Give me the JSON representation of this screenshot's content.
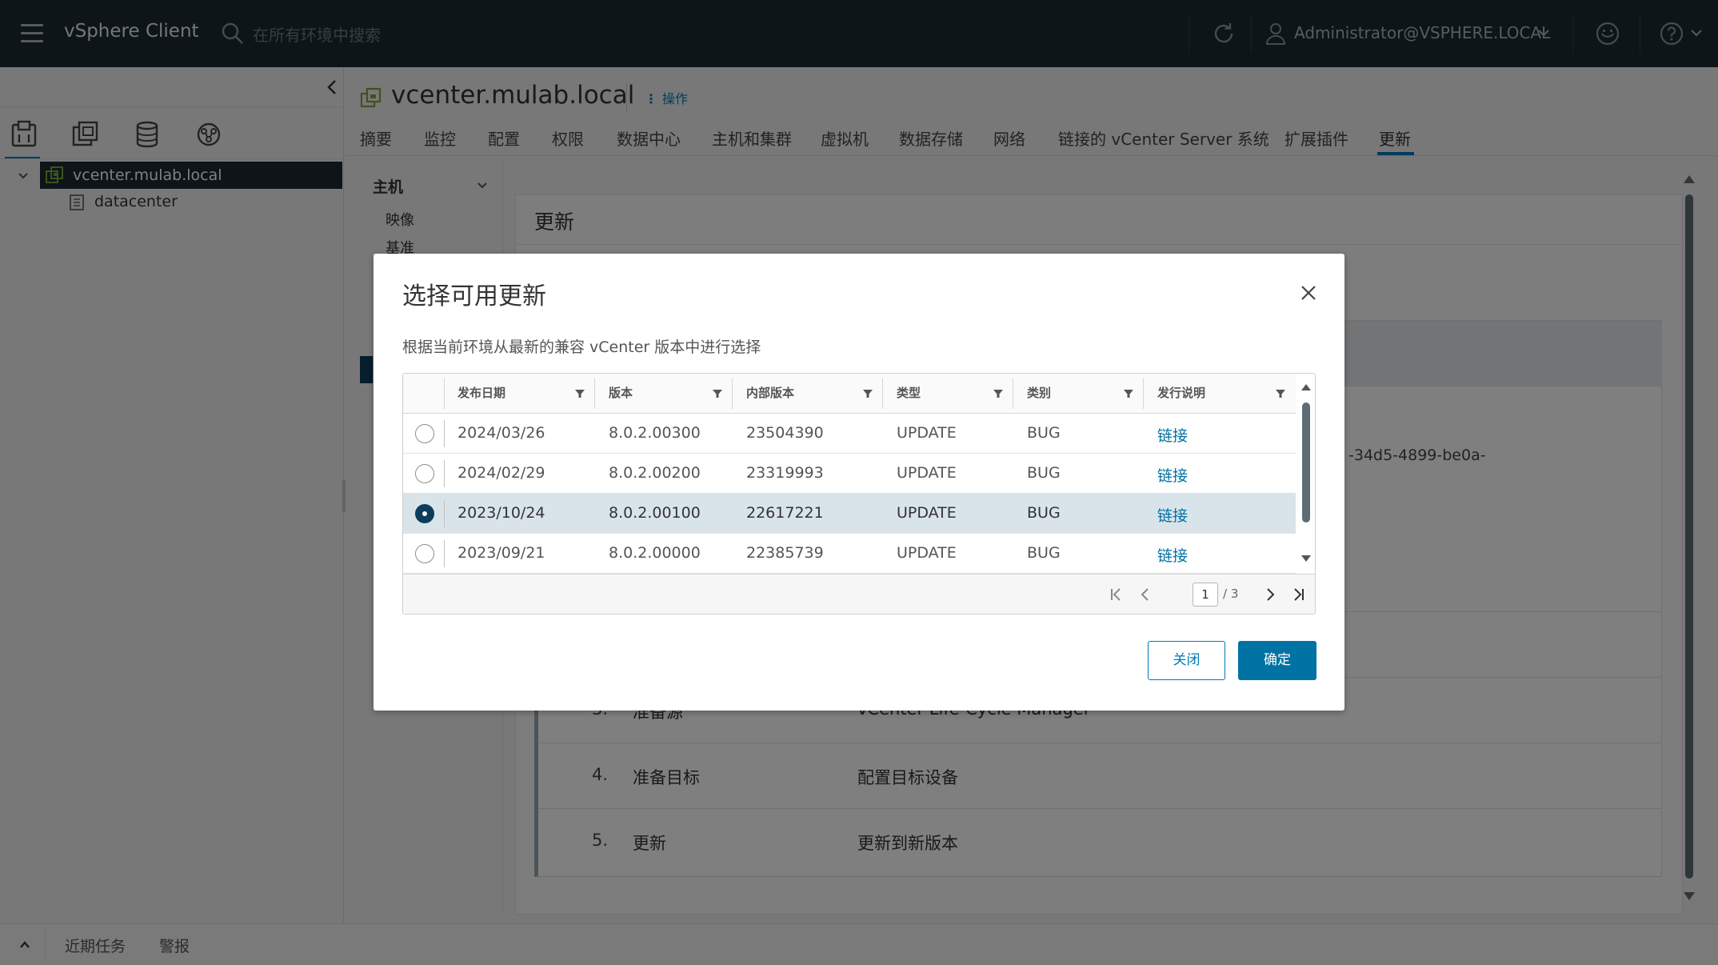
{
  "header": {
    "app_title": "vSphere Client",
    "search_placeholder": "在所有环境中搜索",
    "user": "Administrator@VSPHERE.LOCAL"
  },
  "nav": {
    "tree": [
      {
        "label": "vcenter.mulab.local",
        "selected": true
      },
      {
        "label": "datacenter"
      }
    ]
  },
  "main": {
    "object_title": "vcenter.mulab.local",
    "actions_label": "操作",
    "tabs": [
      "摘要",
      "监控",
      "配置",
      "权限",
      "数据中心",
      "主机和集群",
      "虚拟机",
      "数据存储",
      "网络",
      "链接的 vCenter Server 系统",
      "扩展插件",
      "更新"
    ],
    "active_tab": "更新",
    "side_menu": {
      "heading": "主机",
      "items": [
        "映像",
        "基准"
      ]
    },
    "content_title": "更新",
    "uuid_fragment": "-34d5-4899-be0a-",
    "steps": [
      {
        "num": "3.",
        "name": "准备源",
        "desc": "vCenter Life-Cycle Manager"
      },
      {
        "num": "4.",
        "name": "准备目标",
        "desc": "配置目标设备"
      },
      {
        "num": "5.",
        "name": "更新",
        "desc": "更新到新版本"
      }
    ]
  },
  "bottom_bar": {
    "recent_tasks": "近期任务",
    "alarms": "警报"
  },
  "modal": {
    "title": "选择可用更新",
    "description": "根据当前环境从最新的兼容 vCenter 版本中进行选择",
    "columns": [
      "发布日期",
      "版本",
      "内部版本",
      "类型",
      "类别",
      "发行说明"
    ],
    "rows": [
      {
        "date": "2024/03/26",
        "version": "8.0.2.00300",
        "build": "23504390",
        "type": "UPDATE",
        "category": "BUG",
        "notes": "链接",
        "selected": false
      },
      {
        "date": "2024/02/29",
        "version": "8.0.2.00200",
        "build": "23319993",
        "type": "UPDATE",
        "category": "BUG",
        "notes": "链接",
        "selected": false
      },
      {
        "date": "2023/10/24",
        "version": "8.0.2.00100",
        "build": "22617221",
        "type": "UPDATE",
        "category": "BUG",
        "notes": "链接",
        "selected": true
      },
      {
        "date": "2023/09/21",
        "version": "8.0.2.00000",
        "build": "22385739",
        "type": "UPDATE",
        "category": "BUG",
        "notes": "链接",
        "selected": false
      }
    ],
    "pagination": {
      "current_page": "1",
      "total": "/ 3"
    },
    "close_button": "关闭",
    "ok_button": "确定"
  },
  "colors": {
    "header_bg": "#1b2a32",
    "accent": "#0079b8",
    "primary_button": "#0072a3",
    "selected_row": "#d9e4ea"
  }
}
